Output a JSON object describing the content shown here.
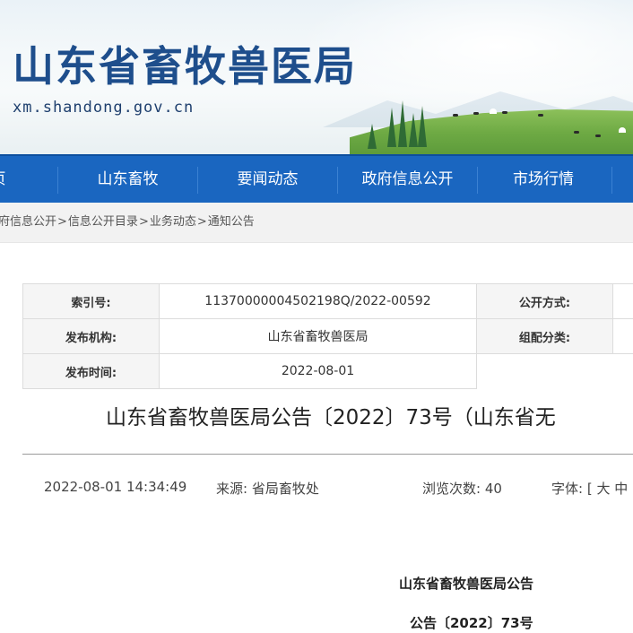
{
  "site": {
    "title": "山东省畜牧兽医局",
    "domain": "xm.shandong.gov.cn"
  },
  "nav": {
    "items": [
      {
        "label": "页"
      },
      {
        "label": "山东畜牧"
      },
      {
        "label": "要闻动态"
      },
      {
        "label": "政府信息公开"
      },
      {
        "label": "市场行情"
      }
    ]
  },
  "breadcrumb": {
    "items": [
      "府信息公开",
      "信息公开目录",
      "业务动态",
      "通知公告"
    ],
    "separator": ">"
  },
  "meta": {
    "index_label": "索引号:",
    "index_value": "11370000004502198Q/2022-00592",
    "open_method_label": "公开方式:",
    "publisher_label": "发布机构:",
    "publisher_value": "山东省畜牧兽医局",
    "category_label": "组配分类:",
    "date_label": "发布时间:",
    "date_value": "2022-08-01"
  },
  "article": {
    "title": "山东省畜牧兽医局公告〔2022〕73号（山东省无",
    "datetime": "2022-08-01 14:34:49",
    "source_label": "来源:",
    "source_value": "省局畜牧处",
    "views_label": "浏览次数:",
    "views_value": "40",
    "font_label": "字体:",
    "font_open": "[",
    "font_large": "大",
    "font_medium": "中",
    "body_heading": "山东省畜牧兽医局公告",
    "body_line": "公告〔2022〕73号"
  },
  "colors": {
    "nav_bg": "#1a66c0",
    "title_blue": "#1e4e8c",
    "meta_label_bg": "#f5f5f5"
  }
}
